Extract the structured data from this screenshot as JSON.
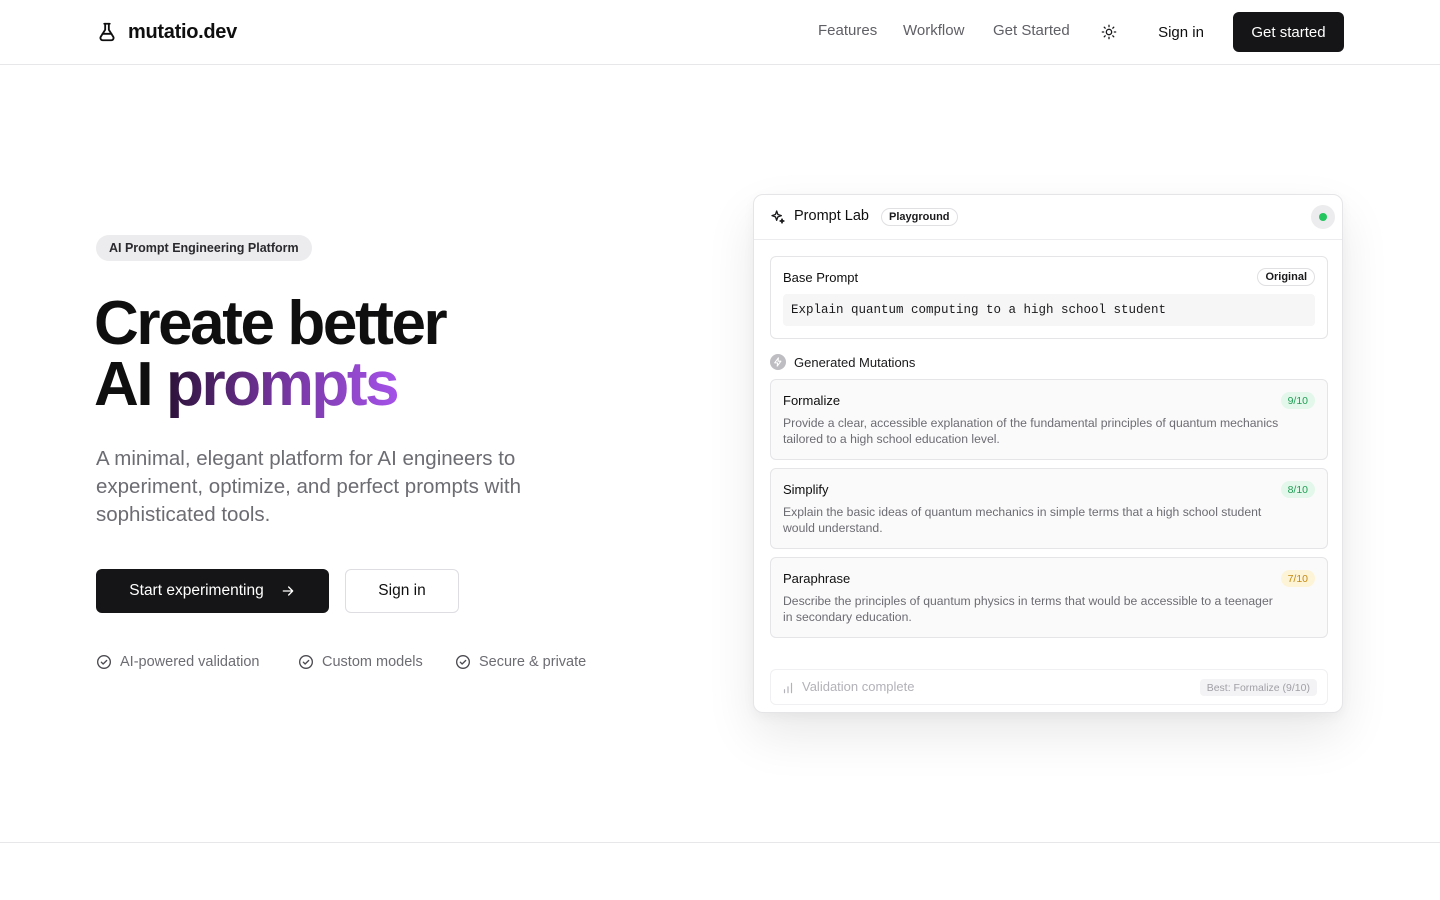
{
  "header": {
    "brand": "mutatio.dev",
    "nav": [
      "Features",
      "Workflow",
      "Get Started"
    ],
    "sign_in": "Sign in",
    "cta": "Get started"
  },
  "hero": {
    "badge": "AI Prompt Engineering Platform",
    "headline_line1": "Create better",
    "headline_line2_plain": "AI",
    "headline_line2_gradient": "prompts",
    "lead": "A minimal, elegant platform for AI engineers to experiment, optimize, and perfect prompts with sophisticated tools.",
    "primary_button": "Start experimenting",
    "secondary_button": "Sign in",
    "features": [
      "AI-powered validation",
      "Custom models",
      "Secure & private"
    ],
    "gradient_colors": [
      "#2b1238",
      "#6a2f8f",
      "#a452e8"
    ]
  },
  "prompt_lab": {
    "title": "Prompt Lab",
    "mode_pill": "Playground",
    "status_color": "#22c55e",
    "base_prompt": {
      "label": "Base Prompt",
      "tag": "Original",
      "text": "Explain quantum computing to a high school student"
    },
    "mutations_heading": "Generated Mutations",
    "mutations": [
      {
        "name": "Formalize",
        "score": "9/10",
        "description": "Provide a clear, accessible explanation of the fundamental principles of quantum mechanics tailored to a high school education level."
      },
      {
        "name": "Simplify",
        "score": "8/10",
        "description": "Explain the basic ideas of quantum mechanics in simple terms that a high school student would understand."
      },
      {
        "name": "Paraphrase",
        "score": "7/10",
        "description": "Describe the principles of quantum physics in terms that would be accessible to a teenager in secondary education."
      }
    ],
    "validation_status": "Validation complete",
    "best_result": "Best: Formalize (9/10)"
  }
}
